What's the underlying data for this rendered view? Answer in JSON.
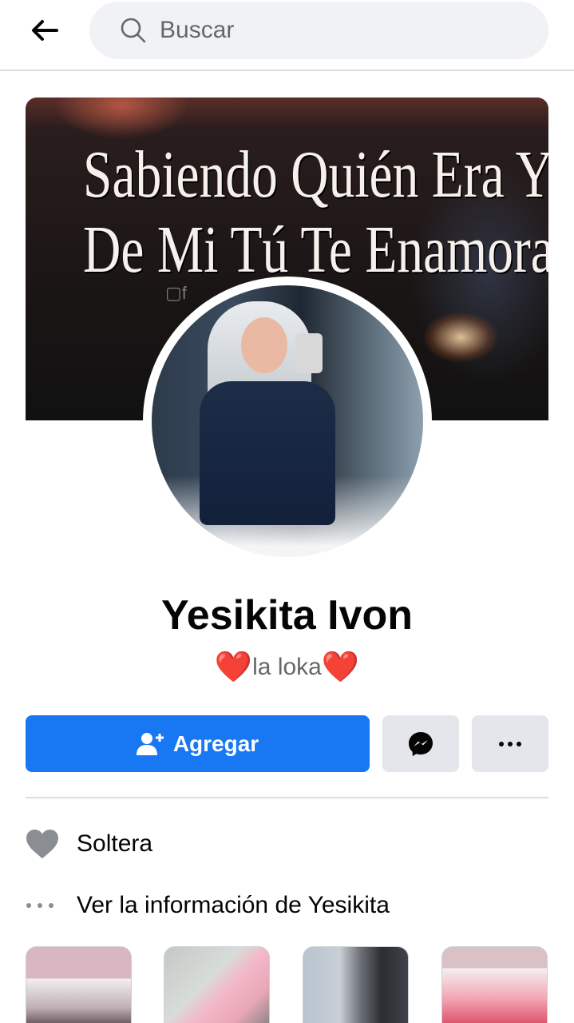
{
  "header": {
    "back_label": "Back",
    "search_placeholder": "Buscar"
  },
  "cover": {
    "line1": "Sabiendo Quién Era Yo",
    "line2": "De Mi Tú Te Enamoraste"
  },
  "profile": {
    "name": "Yesikita Ivon",
    "bio_text": "la loka",
    "bio_emoji": "❤️"
  },
  "actions": {
    "add_label": "Agregar"
  },
  "info": {
    "relationship": "Soltera",
    "see_info": "Ver la información de Yesikita"
  },
  "colors": {
    "primary": "#1877f2",
    "secondary_button": "#e4e6eb",
    "muted_text": "#65676b",
    "heart": "#e41e3f"
  }
}
